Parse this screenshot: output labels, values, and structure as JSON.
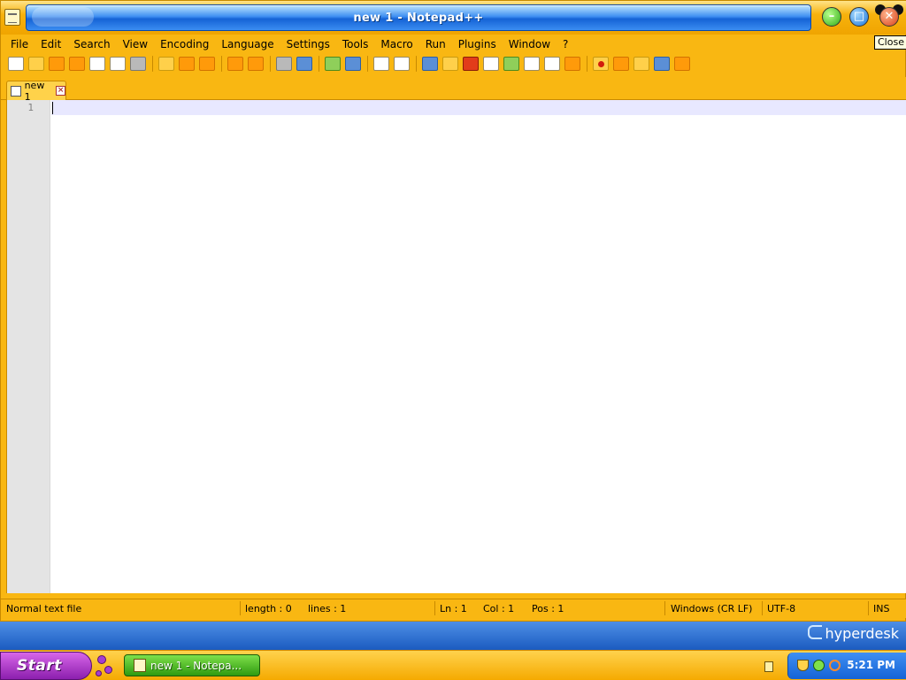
{
  "window": {
    "title": "new 1 - Notepad++",
    "tooltip": "Close"
  },
  "menu": [
    "File",
    "Edit",
    "Search",
    "View",
    "Encoding",
    "Language",
    "Settings",
    "Tools",
    "Macro",
    "Run",
    "Plugins",
    "Window",
    "?"
  ],
  "toolbar": {
    "icons": [
      "new-file-icon",
      "open-file-icon",
      "save-icon",
      "save-all-icon",
      "close-icon",
      "close-all-icon",
      "print-icon",
      "cut-icon",
      "copy-icon",
      "paste-icon",
      "undo-icon",
      "redo-icon",
      "find-icon",
      "replace-icon",
      "zoom-in-icon",
      "zoom-out-icon",
      "sync-vertical-icon",
      "sync-horizontal-icon",
      "word-wrap-icon",
      "show-all-chars-icon",
      "indent-guide-icon",
      "user-language-icon",
      "doc-map-icon",
      "function-list-icon",
      "folder-workspace-icon",
      "monitoring-icon",
      "record-macro-icon",
      "stop-record-icon",
      "play-macro-icon",
      "run-macro-multiple-icon",
      "save-macro-icon"
    ]
  },
  "tabs": [
    {
      "label": "new 1"
    }
  ],
  "editor": {
    "line_numbers": [
      "1"
    ],
    "content": ""
  },
  "status": {
    "file_type": "Normal text file",
    "length": "length : 0",
    "lines": "lines : 1",
    "ln": "Ln : 1",
    "col": "Col : 1",
    "pos": "Pos : 1",
    "eol": "Windows (CR LF)",
    "encoding": "UTF-8",
    "mode": "INS"
  },
  "desktop": {
    "brand": "hyperdesk"
  },
  "taskbar": {
    "start_label": "Start",
    "task_label": "new 1 - Notepa...",
    "clock": "5:21 PM"
  },
  "colors": {
    "theme_yellow": "#f9b712",
    "title_blue": "#1563d6",
    "start_purple": "#8c1fae",
    "task_green": "#2f9a10"
  }
}
